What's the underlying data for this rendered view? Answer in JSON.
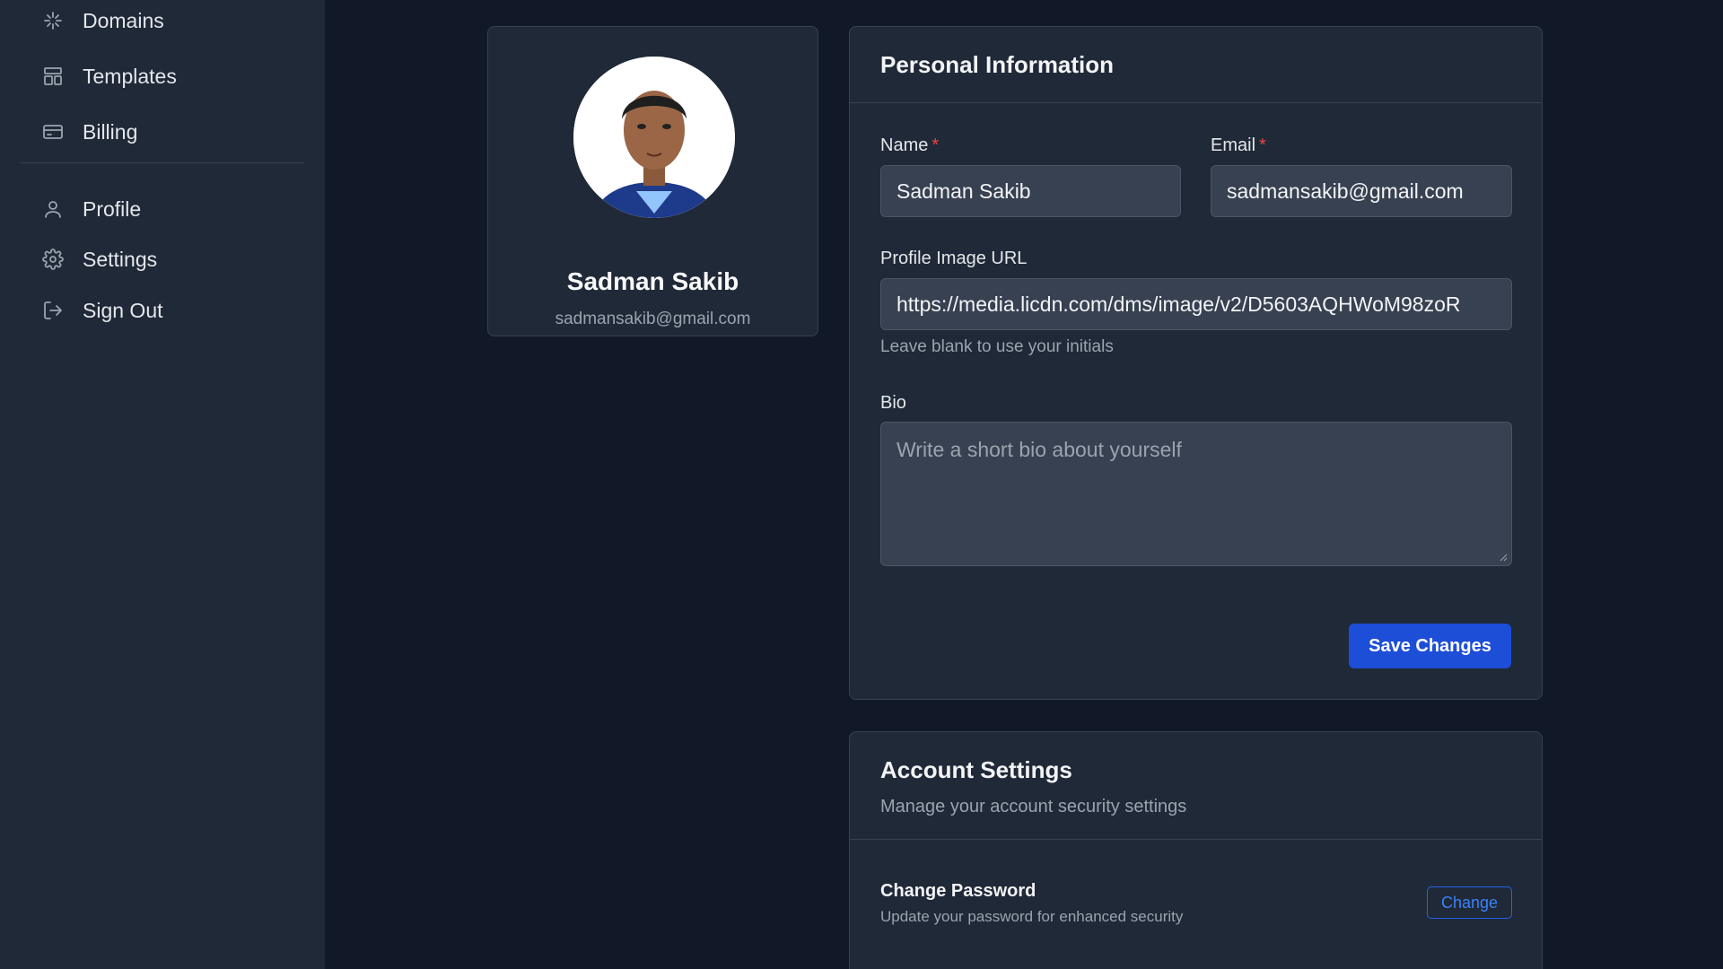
{
  "sidebar": {
    "items": [
      {
        "label": "Domains",
        "icon": "domains-icon"
      },
      {
        "label": "Templates",
        "icon": "templates-icon"
      },
      {
        "label": "Billing",
        "icon": "billing-icon"
      },
      {
        "label": "Profile",
        "icon": "user-icon"
      },
      {
        "label": "Settings",
        "icon": "gear-icon"
      },
      {
        "label": "Sign Out",
        "icon": "sign-out-icon"
      }
    ]
  },
  "profile_card": {
    "name": "Sadman Sakib",
    "email": "sadmansakib@gmail.com"
  },
  "personal_info": {
    "title": "Personal Information",
    "name_label": "Name",
    "email_label": "Email",
    "required_marker": "*",
    "name_value": "Sadman Sakib",
    "email_value": "sadmansakib@gmail.com",
    "image_url_label": "Profile Image URL",
    "image_url_value": "https://media.licdn.com/dms/image/v2/D5603AQHWoM98zoR",
    "image_url_hint": "Leave blank to use your initials",
    "bio_label": "Bio",
    "bio_placeholder": "Write a short bio about yourself",
    "save_label": "Save Changes"
  },
  "account_settings": {
    "title": "Account Settings",
    "subtitle": "Manage your account security settings",
    "password_title": "Change Password",
    "password_subtitle": "Update your password for enhanced security",
    "change_label": "Change"
  },
  "colors": {
    "background": "#111827",
    "panel": "#1f2937",
    "accent": "#1d4ed8",
    "required": "#ef4444"
  }
}
